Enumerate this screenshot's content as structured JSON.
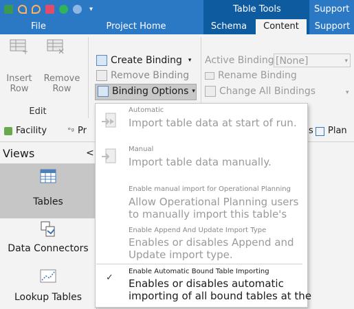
{
  "titlebar": {
    "context_group": "Table Tools",
    "support_group": "Support"
  },
  "tabs": {
    "file": "File",
    "project_home": "Project Home",
    "schema": "Schema",
    "content": "Content",
    "support": "Support"
  },
  "ribbon": {
    "insert_row": "Insert Row",
    "remove_row": "Remove Row",
    "edit_group": "Edit",
    "create_binding": "Create Binding",
    "remove_binding": "Remove Binding",
    "binding_options": "Binding Options",
    "active_binding_label": "Active Binding",
    "active_binding_value": "[None]",
    "rename_binding": "Rename Binding",
    "change_all_bindings": "Change All Bindings"
  },
  "secondary_tabs": {
    "facility": "Facility",
    "pr_partial": "Pr",
    "s_partial": "s",
    "plan_partial": "Plan"
  },
  "views": {
    "header": "Views",
    "collapse_glyph": "<",
    "items": [
      {
        "label": "Tables"
      },
      {
        "label": "Data Connectors"
      },
      {
        "label": "Lookup Tables"
      }
    ]
  },
  "menu": {
    "items": [
      {
        "small": "Automatic",
        "big": "Import table data at start of run."
      },
      {
        "small": "Manual",
        "big": "Import table data manually."
      },
      {
        "small": "Enable manual import for Operational Planning",
        "big1": "Allow Operational Planning users",
        "big2": "to manually import this table's"
      },
      {
        "small": "Enable Append And Update Import Type",
        "big1": "Enables or disables Append and",
        "big2": "Update import type."
      },
      {
        "small": "Enable Automatic Bound Table Importing",
        "big1": "Enables or disables automatic",
        "big2": "importing of all bound tables at the",
        "check": "✓"
      }
    ]
  },
  "colors": {
    "title_blue": "#2b78c4",
    "context_dark_blue": "#0f5b9f",
    "selected_view": "#c6c6c6",
    "binding_options_highlight": "#c8c8c8"
  }
}
